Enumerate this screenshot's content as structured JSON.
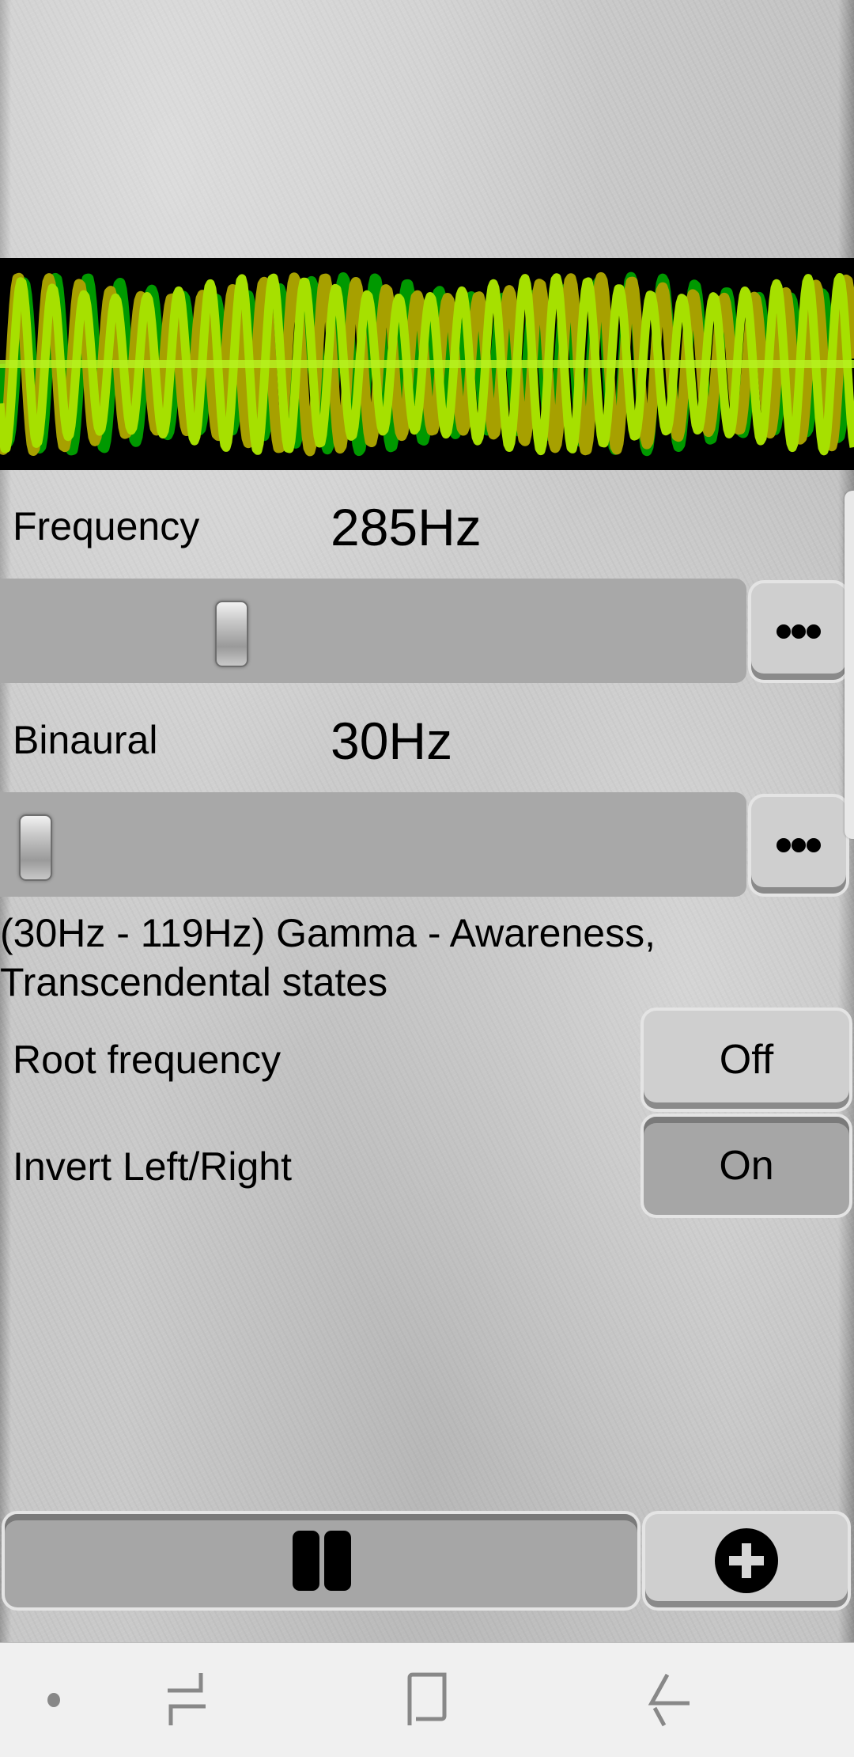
{
  "visualizer": {
    "name": "binaural waveform",
    "colors": [
      "#009900",
      "#a7a000",
      "#a6e000"
    ]
  },
  "frequency": {
    "label": "Frequency",
    "value_text": "285Hz",
    "slider_fraction": 0.29,
    "more_icon": "ellipsis-icon"
  },
  "binaural": {
    "label": "Binaural",
    "value_text": "30Hz",
    "slider_fraction": 0.0,
    "more_icon": "ellipsis-icon"
  },
  "description": {
    "line1": "(30Hz - 119Hz) Gamma - Awareness,",
    "line2": "Transcendental states"
  },
  "options": [
    {
      "label": "Root frequency",
      "state": "Off"
    },
    {
      "label": "Invert Left/Right",
      "state": "On"
    }
  ],
  "controls": {
    "play_pause_icon": "pause-icon",
    "add_icon": "plus-circle-icon"
  },
  "navbar": {
    "icons": [
      "dot-icon",
      "recent-apps-icon",
      "home-icon",
      "back-icon"
    ]
  }
}
